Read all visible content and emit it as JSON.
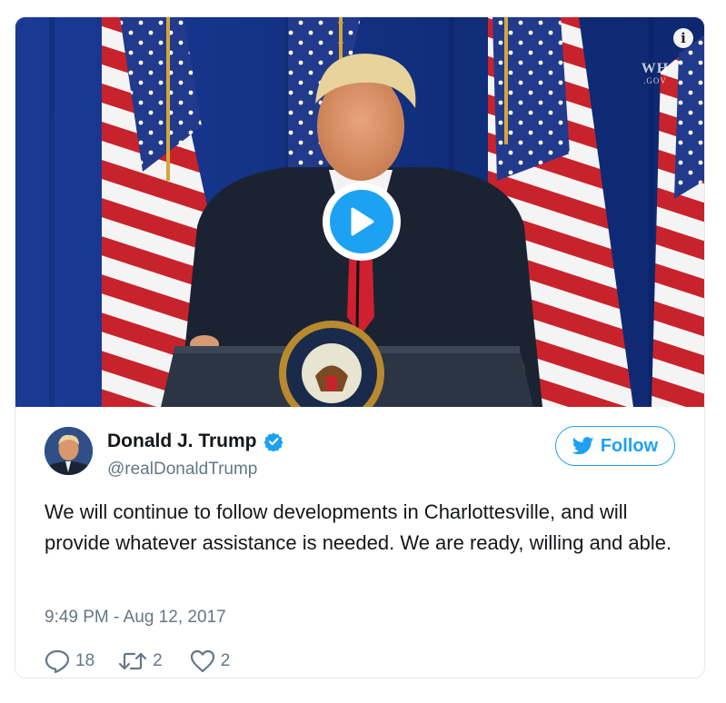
{
  "media": {
    "info_symbol": "i",
    "watermark_line1": "WH",
    "watermark_line2": ".GOV",
    "play_icon": "play-icon",
    "seal_text": "THE PRESIDENT OF THE UNITED"
  },
  "author": {
    "display_name": "Donald J. Trump",
    "handle": "@realDonaldTrump",
    "verified": true,
    "avatar_icon": "avatar-photo"
  },
  "follow_button": {
    "label": "Follow",
    "icon": "bird-icon"
  },
  "tweet": {
    "text": "We will continue to follow developments in Charlottesville, and will provide whatever assistance is needed. We are ready, willing and able.",
    "timestamp": "9:49 PM - Aug 12, 2017"
  },
  "actions": {
    "reply_count": "18",
    "retweet_count": "2",
    "like_count": "2"
  },
  "colors": {
    "accent": "#1da1f2",
    "secondary_text": "#657786",
    "primary_text": "#14171a",
    "border": "#e1e8ed"
  }
}
